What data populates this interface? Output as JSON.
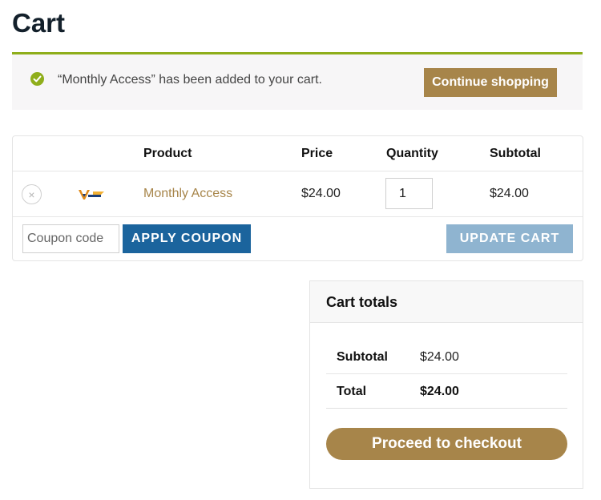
{
  "page": {
    "title": "Cart"
  },
  "notice": {
    "message": "“Monthly Access” has been added to your cart.",
    "continue_label": "Continue shopping",
    "icon": "checkmark-circle-icon",
    "accent": "#8fae1b"
  },
  "cart": {
    "headers": {
      "product": "Product",
      "price": "Price",
      "quantity": "Quantity",
      "subtotal": "Subtotal"
    },
    "items": [
      {
        "remove_icon": "×",
        "product": "Monthly Access",
        "price": "$24.00",
        "quantity": "1",
        "subtotal": "$24.00"
      }
    ],
    "coupon": {
      "placeholder": "Coupon code",
      "value": "",
      "apply_label": "APPLY COUPON"
    },
    "update_label": "UPDATE CART"
  },
  "totals": {
    "title": "Cart totals",
    "subtotal_label": "Subtotal",
    "subtotal_value": "$24.00",
    "total_label": "Total",
    "total_value": "$24.00",
    "checkout_label": "Proceed to checkout"
  },
  "colors": {
    "brand_button": "#a7854a",
    "apply_button": "#1b649d",
    "update_button_disabled": "#8fb4d0",
    "link": "#a7854a"
  }
}
